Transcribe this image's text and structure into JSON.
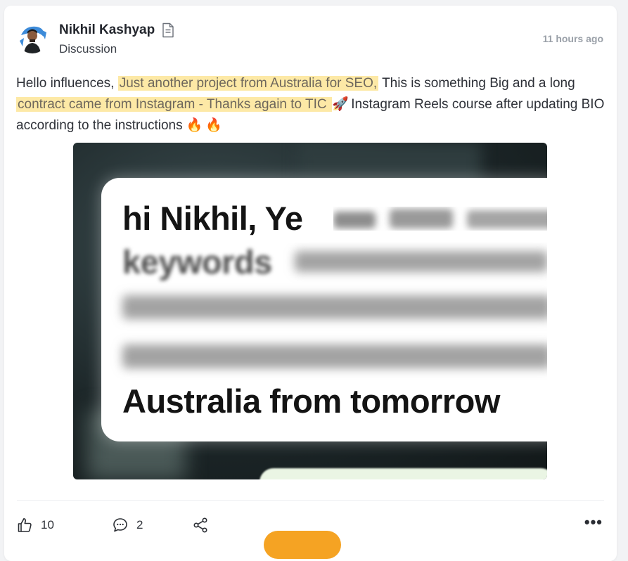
{
  "post": {
    "author_name": "Nikhil Kashyap",
    "category": "Discussion",
    "timestamp": "11 hours ago",
    "body": {
      "part1": "Hello influences, ",
      "highlight1": "Just another project from Australia for SEO,",
      "part2": " This is something Big and a long ",
      "highlight2": "contract came from Instagram - Thanks again to TIC ",
      "rocket_emoji": "🚀",
      "part3": " Instagram Reels course after updating BIO according to the instructions ",
      "fire_emoji_1": "🔥",
      "fire_emoji_2": "🔥"
    },
    "attachment": {
      "line1": "hi Nikhil, Ye",
      "line2": "keywords",
      "line5": "Australia from tomorrow"
    },
    "likes_count": "10",
    "comments_count": "2"
  },
  "colors": {
    "highlight": "#fde9a6",
    "accent_button": "#f5a323",
    "timestamp": "#9aa0a8"
  },
  "icons": {
    "doc": "document-icon",
    "like": "thumbs-up-icon",
    "comment": "comment-icon",
    "share": "share-icon",
    "more": "more-options-icon"
  }
}
